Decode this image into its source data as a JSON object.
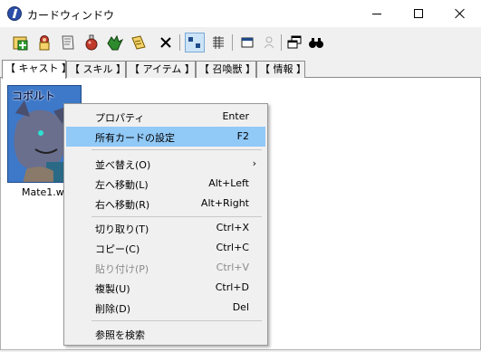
{
  "window": {
    "title": "カードウィンドウ"
  },
  "toolbar": {
    "buttons": [
      {
        "name": "new-card-icon",
        "color": "#2e9e2e"
      },
      {
        "name": "person-card-icon",
        "color": "#c0392b"
      },
      {
        "name": "skill-card-icon",
        "color": "#d8d8d8"
      },
      {
        "name": "potion-icon",
        "color": "#c0392b"
      },
      {
        "name": "dragon-icon",
        "color": "#2e8b2e"
      },
      {
        "name": "info-card-icon",
        "color": "#e6c200"
      },
      {
        "name": "delete-icon",
        "color": "#000000"
      },
      {
        "name": "view-large-icon",
        "color": "#1f4a8a"
      },
      {
        "name": "view-list-icon",
        "color": "#333333"
      },
      {
        "name": "window-icon",
        "color": "#1f4a8a"
      },
      {
        "name": "person-disabled-icon",
        "color": "#b0b0b0"
      },
      {
        "name": "cascade-windows-icon",
        "color": "#000000"
      },
      {
        "name": "find-icon",
        "color": "#000000"
      }
    ]
  },
  "tabs": [
    {
      "label": "【 キャスト 】",
      "active": true
    },
    {
      "label": "【 スキル 】",
      "active": false
    },
    {
      "label": "【 アイテム 】",
      "active": false
    },
    {
      "label": "【 召喚獣 】",
      "active": false
    },
    {
      "label": "【 情報 】",
      "active": false
    }
  ],
  "card": {
    "name": "コボルト",
    "file_label": "Mate1.wid"
  },
  "context_menu": {
    "items": [
      {
        "label": "プロパティ",
        "shortcut": "Enter"
      },
      {
        "label": "所有カードの設定",
        "shortcut": "F2",
        "highlighted": true
      },
      {
        "label": "並べ替え(O)",
        "submenu": true
      },
      {
        "label": "左へ移動(L)",
        "shortcut": "Alt+Left"
      },
      {
        "label": "右へ移動(R)",
        "shortcut": "Alt+Right"
      },
      {
        "label": "切り取り(T)",
        "shortcut": "Ctrl+X"
      },
      {
        "label": "コピー(C)",
        "shortcut": "Ctrl+C"
      },
      {
        "label": "貼り付け(P)",
        "shortcut": "Ctrl+V",
        "disabled": true
      },
      {
        "label": "複製(U)",
        "shortcut": "Ctrl+D"
      },
      {
        "label": "削除(D)",
        "shortcut": "Del"
      },
      {
        "label": "参照を検索"
      }
    ]
  }
}
